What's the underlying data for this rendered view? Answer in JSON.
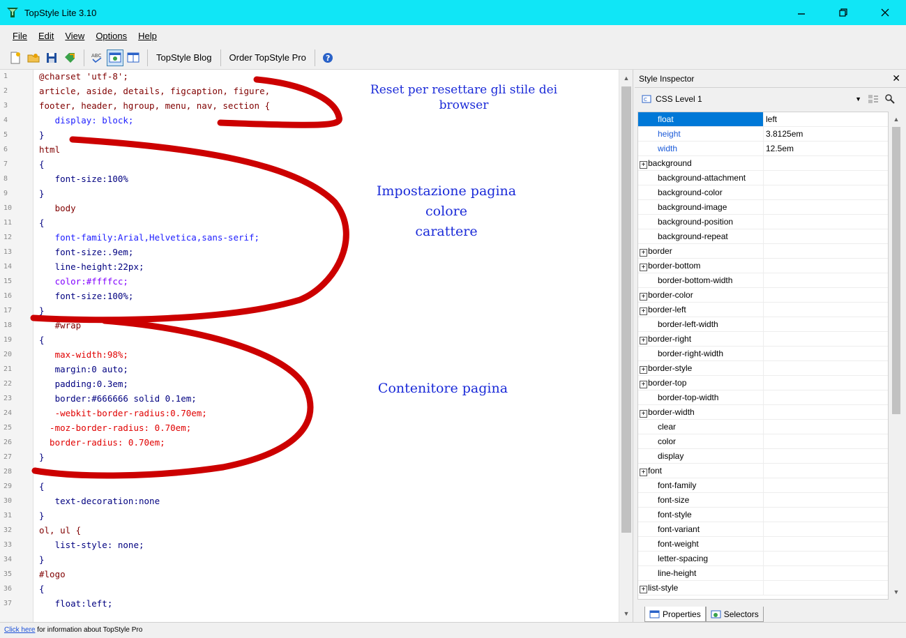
{
  "window": {
    "title": "TopStyle Lite 3.10"
  },
  "menu": [
    "File",
    "Edit",
    "View",
    "Options",
    "Help"
  ],
  "toolbar": {
    "blog_label": "TopStyle Blog",
    "order_label": "Order TopStyle Pro"
  },
  "editor": {
    "line_numbers": [
      "1",
      "2",
      "3",
      "4",
      "5",
      "6",
      "7",
      "8",
      "9",
      "10",
      "11",
      "12",
      "13",
      "14",
      "15",
      "16",
      "17",
      "18",
      "19",
      "20",
      "21",
      "22",
      "23",
      "24",
      "25",
      "26",
      "27",
      "28",
      "29",
      "30",
      "31",
      "32",
      "33",
      "34",
      "35",
      "36",
      "37"
    ],
    "lines": [
      "@charset 'utf-8';",
      "article, aside, details, figcaption, figure,",
      "footer, header, hgroup, menu, nav, section {",
      "   display: block;",
      "}",
      "html",
      "{",
      "   font-size:100%",
      "}",
      "   body",
      "{",
      "   font-family:Arial,Helvetica,sans-serif;",
      "   font-size:.9em;",
      "   line-height:22px;",
      "   color:#ffffcc;",
      "   font-size:100%;",
      "}",
      "   #wrap",
      "{",
      "   max-width:98%;",
      "   margin:0 auto;",
      "   padding:0.3em;",
      "   border:#666666 solid 0.1em;",
      "   -webkit-border-radius:0.70em;",
      "  -moz-border-radius: 0.70em;",
      "  border-radius: 0.70em;",
      "}",
      "a",
      "{",
      "   text-decoration:none",
      "}",
      "ol, ul {",
      "   list-style: none;",
      "}",
      "#logo",
      "{",
      "   float:left;"
    ],
    "annotations": [
      {
        "lines": [
          "Reset per resettare gli stile dei",
          "browser"
        ]
      },
      {
        "lines": [
          "Impostazione pagina",
          "colore",
          "carattere"
        ]
      },
      {
        "lines": [
          "Contenitore pagina"
        ]
      }
    ]
  },
  "inspector": {
    "title": "Style Inspector",
    "level": "CSS Level 1",
    "properties": [
      {
        "name": "float",
        "value": "left",
        "state": "selected",
        "group": false
      },
      {
        "name": "height",
        "value": "3.8125em",
        "state": "set",
        "group": false
      },
      {
        "name": "width",
        "value": "12.5em",
        "state": "set",
        "group": false
      },
      {
        "name": "background",
        "value": "",
        "state": "",
        "group": true
      },
      {
        "name": "background-attachment",
        "value": "",
        "state": "",
        "group": false
      },
      {
        "name": "background-color",
        "value": "",
        "state": "",
        "group": false
      },
      {
        "name": "background-image",
        "value": "",
        "state": "",
        "group": false
      },
      {
        "name": "background-position",
        "value": "",
        "state": "",
        "group": false
      },
      {
        "name": "background-repeat",
        "value": "",
        "state": "",
        "group": false
      },
      {
        "name": "border",
        "value": "",
        "state": "",
        "group": true
      },
      {
        "name": "border-bottom",
        "value": "",
        "state": "",
        "group": true
      },
      {
        "name": "border-bottom-width",
        "value": "",
        "state": "",
        "group": false
      },
      {
        "name": "border-color",
        "value": "",
        "state": "",
        "group": true
      },
      {
        "name": "border-left",
        "value": "",
        "state": "",
        "group": true
      },
      {
        "name": "border-left-width",
        "value": "",
        "state": "",
        "group": false
      },
      {
        "name": "border-right",
        "value": "",
        "state": "",
        "group": true
      },
      {
        "name": "border-right-width",
        "value": "",
        "state": "",
        "group": false
      },
      {
        "name": "border-style",
        "value": "",
        "state": "",
        "group": true
      },
      {
        "name": "border-top",
        "value": "",
        "state": "",
        "group": true
      },
      {
        "name": "border-top-width",
        "value": "",
        "state": "",
        "group": false
      },
      {
        "name": "border-width",
        "value": "",
        "state": "",
        "group": true
      },
      {
        "name": "clear",
        "value": "",
        "state": "",
        "group": false
      },
      {
        "name": "color",
        "value": "",
        "state": "",
        "group": false
      },
      {
        "name": "display",
        "value": "",
        "state": "",
        "group": false
      },
      {
        "name": "font",
        "value": "",
        "state": "",
        "group": true
      },
      {
        "name": "font-family",
        "value": "",
        "state": "",
        "group": false
      },
      {
        "name": "font-size",
        "value": "",
        "state": "",
        "group": false
      },
      {
        "name": "font-style",
        "value": "",
        "state": "",
        "group": false
      },
      {
        "name": "font-variant",
        "value": "",
        "state": "",
        "group": false
      },
      {
        "name": "font-weight",
        "value": "",
        "state": "",
        "group": false
      },
      {
        "name": "letter-spacing",
        "value": "",
        "state": "",
        "group": false
      },
      {
        "name": "line-height",
        "value": "",
        "state": "",
        "group": false
      },
      {
        "name": "list-style",
        "value": "",
        "state": "",
        "group": true
      }
    ],
    "tabs": [
      "Properties",
      "Selectors"
    ]
  },
  "status": {
    "link_text": "Click here",
    "text": " for information about TopStyle Pro"
  },
  "colors": {
    "titlebar": "#10e6f6",
    "selection": "#0078d7",
    "annotation_ink": "#cc0000",
    "annotation_text": "#1a2ad8"
  }
}
